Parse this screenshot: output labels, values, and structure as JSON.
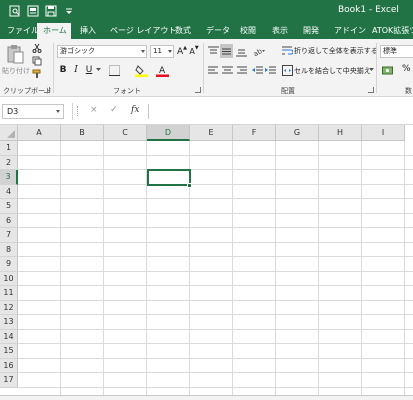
{
  "window": {
    "title": "Book1  -  Excel"
  },
  "quick_access": {
    "icons": [
      "preview-icon",
      "print-icon",
      "save-icon",
      "customize-qat-icon"
    ]
  },
  "tabs": [
    {
      "label": "ファイル",
      "active": false
    },
    {
      "label": "ホーム",
      "active": true
    },
    {
      "label": "挿入",
      "active": false
    },
    {
      "label": "ページ レイアウト",
      "active": false
    },
    {
      "label": "数式",
      "active": false
    },
    {
      "label": "データ",
      "active": false
    },
    {
      "label": "校閲",
      "active": false
    },
    {
      "label": "表示",
      "active": false
    },
    {
      "label": "開発",
      "active": false
    },
    {
      "label": "アドイン",
      "active": false
    },
    {
      "label": "ATOK拡張ツー",
      "active": false
    }
  ],
  "ribbon": {
    "clipboard": {
      "paste_label": "貼り付け",
      "group_label": "クリップボード"
    },
    "font": {
      "font_name": "游ゴシック",
      "font_size": "11",
      "bold": "B",
      "italic": "I",
      "underline": "U",
      "grow": "A",
      "shrink": "A",
      "group_label": "フォント",
      "font_color": "#e81123",
      "fill_color": "#ffff00"
    },
    "alignment": {
      "wrap_text": "折り返して全体を表示する",
      "merge_center": "セルを結合して中央揃え",
      "group_label": "配置"
    },
    "number": {
      "format": "標準",
      "percent": "%",
      "group_label": "数"
    }
  },
  "formula_bar": {
    "name_box": "D3",
    "cancel": "×",
    "enter": "✓",
    "fx": "fx",
    "formula": ""
  },
  "sheet": {
    "columns": [
      "A",
      "B",
      "C",
      "D",
      "E",
      "F",
      "G",
      "H",
      "I"
    ],
    "rows": [
      "1",
      "2",
      "3",
      "4",
      "5",
      "6",
      "7",
      "8",
      "9",
      "10",
      "11",
      "12",
      "13",
      "14",
      "15",
      "16",
      "17"
    ],
    "selected_cell": "D3",
    "accent": "#217346"
  }
}
